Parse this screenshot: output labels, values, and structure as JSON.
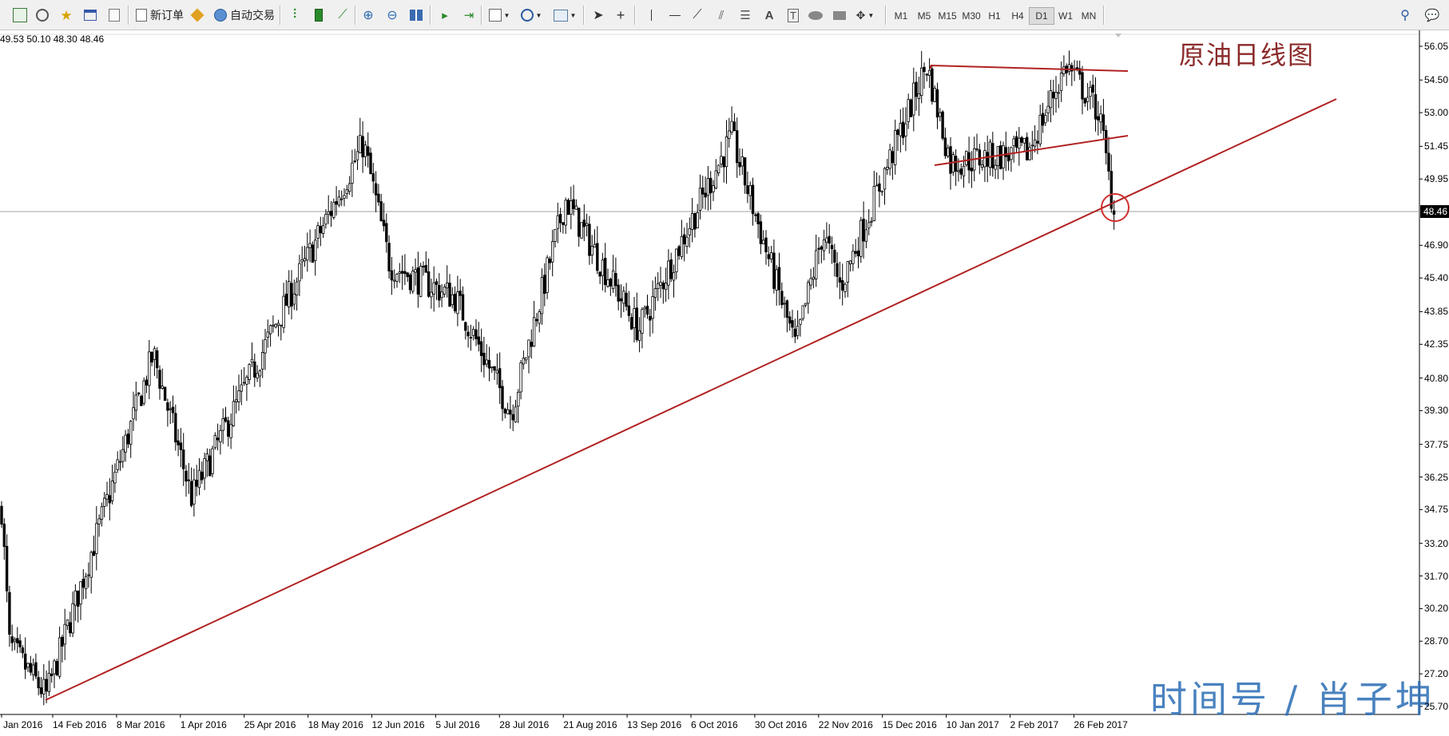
{
  "toolbar": {
    "new_order": "新订单",
    "auto_trading": "自动交易",
    "timeframes": [
      "M1",
      "M5",
      "M15",
      "M30",
      "H1",
      "H4",
      "D1",
      "W1",
      "MN"
    ],
    "active_timeframe": "D1"
  },
  "chart": {
    "ohlc_text": "49.53 50.10 48.30 48.46",
    "title_annotation": "原油日线图",
    "watermark": "时间号 / 肖子坤",
    "current_price_label": "48.46",
    "price_ticks": [
      "56.05",
      "54.50",
      "53.00",
      "51.45",
      "49.95",
      "46.90",
      "45.40",
      "43.85",
      "42.35",
      "40.80",
      "39.30",
      "37.75",
      "36.25",
      "34.75",
      "33.20",
      "31.70",
      "30.20",
      "28.70",
      "27.20",
      "25.70"
    ],
    "date_ticks": [
      "Jan 2016",
      "14 Feb 2016",
      "8 Mar 2016",
      "1 Apr 2016",
      "25 Apr 2016",
      "18 May 2016",
      "12 Jun 2016",
      "5 Jul 2016",
      "28 Jul 2016",
      "21 Aug 2016",
      "13 Sep 2016",
      "6 Oct 2016",
      "30 Oct 2016",
      "22 Nov 2016",
      "15 Dec 2016",
      "10 Jan 2017",
      "2 Feb 2017",
      "26 Feb 2017"
    ]
  },
  "chart_data": {
    "type": "candlestick",
    "symbol": "Crude Oil",
    "timeframe": "D1",
    "ylim": [
      25.7,
      56.05
    ],
    "last_bar": {
      "open": 49.53,
      "high": 50.1,
      "low": 48.3,
      "close": 48.46
    },
    "swing_points": [
      {
        "date": "Jan 2016",
        "price": 34.8
      },
      {
        "date": "Jan 2016",
        "price": 28.5
      },
      {
        "date": "14 Feb 2016",
        "price": 26.2
      },
      {
        "date": "18 Mar 2016",
        "price": 41.9
      },
      {
        "date": "5 Apr 2016",
        "price": 35.3
      },
      {
        "date": "9 Jun 2016",
        "price": 51.6
      },
      {
        "date": "1 Jul 2016",
        "price": 46.0
      },
      {
        "date": "21 Jul 2016",
        "price": 44.5
      },
      {
        "date": "3 Aug 2016",
        "price": 39.2
      },
      {
        "date": "21 Aug 2016",
        "price": 49.0
      },
      {
        "date": "13 Sep 2016",
        "price": 43.0
      },
      {
        "date": "10 Oct 2016",
        "price": 51.9
      },
      {
        "date": "3 Nov 2016",
        "price": 42.2
      },
      {
        "date": "22 Nov 2016",
        "price": 47.5
      },
      {
        "date": "30 Nov 2016",
        "price": 45.0
      },
      {
        "date": "3 Jan 2017",
        "price": 55.2
      },
      {
        "date": "10 Jan 2017",
        "price": 50.7
      },
      {
        "date": "2 Feb 2017",
        "price": 51.2
      },
      {
        "date": "26 Feb 2017",
        "price": 55.2
      },
      {
        "date": "3 Mar 2017",
        "price": 53.0
      },
      {
        "date": "9 Mar 2017",
        "price": 48.3
      }
    ]
  }
}
